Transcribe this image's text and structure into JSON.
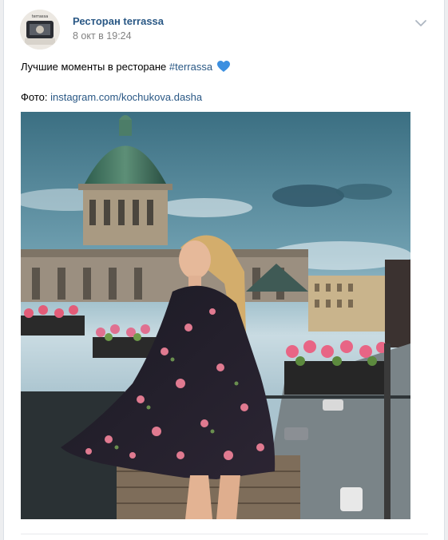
{
  "post": {
    "author": "Ресторан terrassa",
    "date": "8 окт в 19:24",
    "text_before_tag": "Лучшие моменты в ресторане ",
    "hashtag": "#terrassa",
    "photo_prefix": "Фото: ",
    "photo_link": "instagram.com/kochukova.dasha",
    "avatar_caption": "terrassa",
    "heart_emoji": "blue-heart-icon"
  },
  "colors": {
    "link": "#2a5885",
    "date": "#828282",
    "heart": "#3b8fe0"
  }
}
